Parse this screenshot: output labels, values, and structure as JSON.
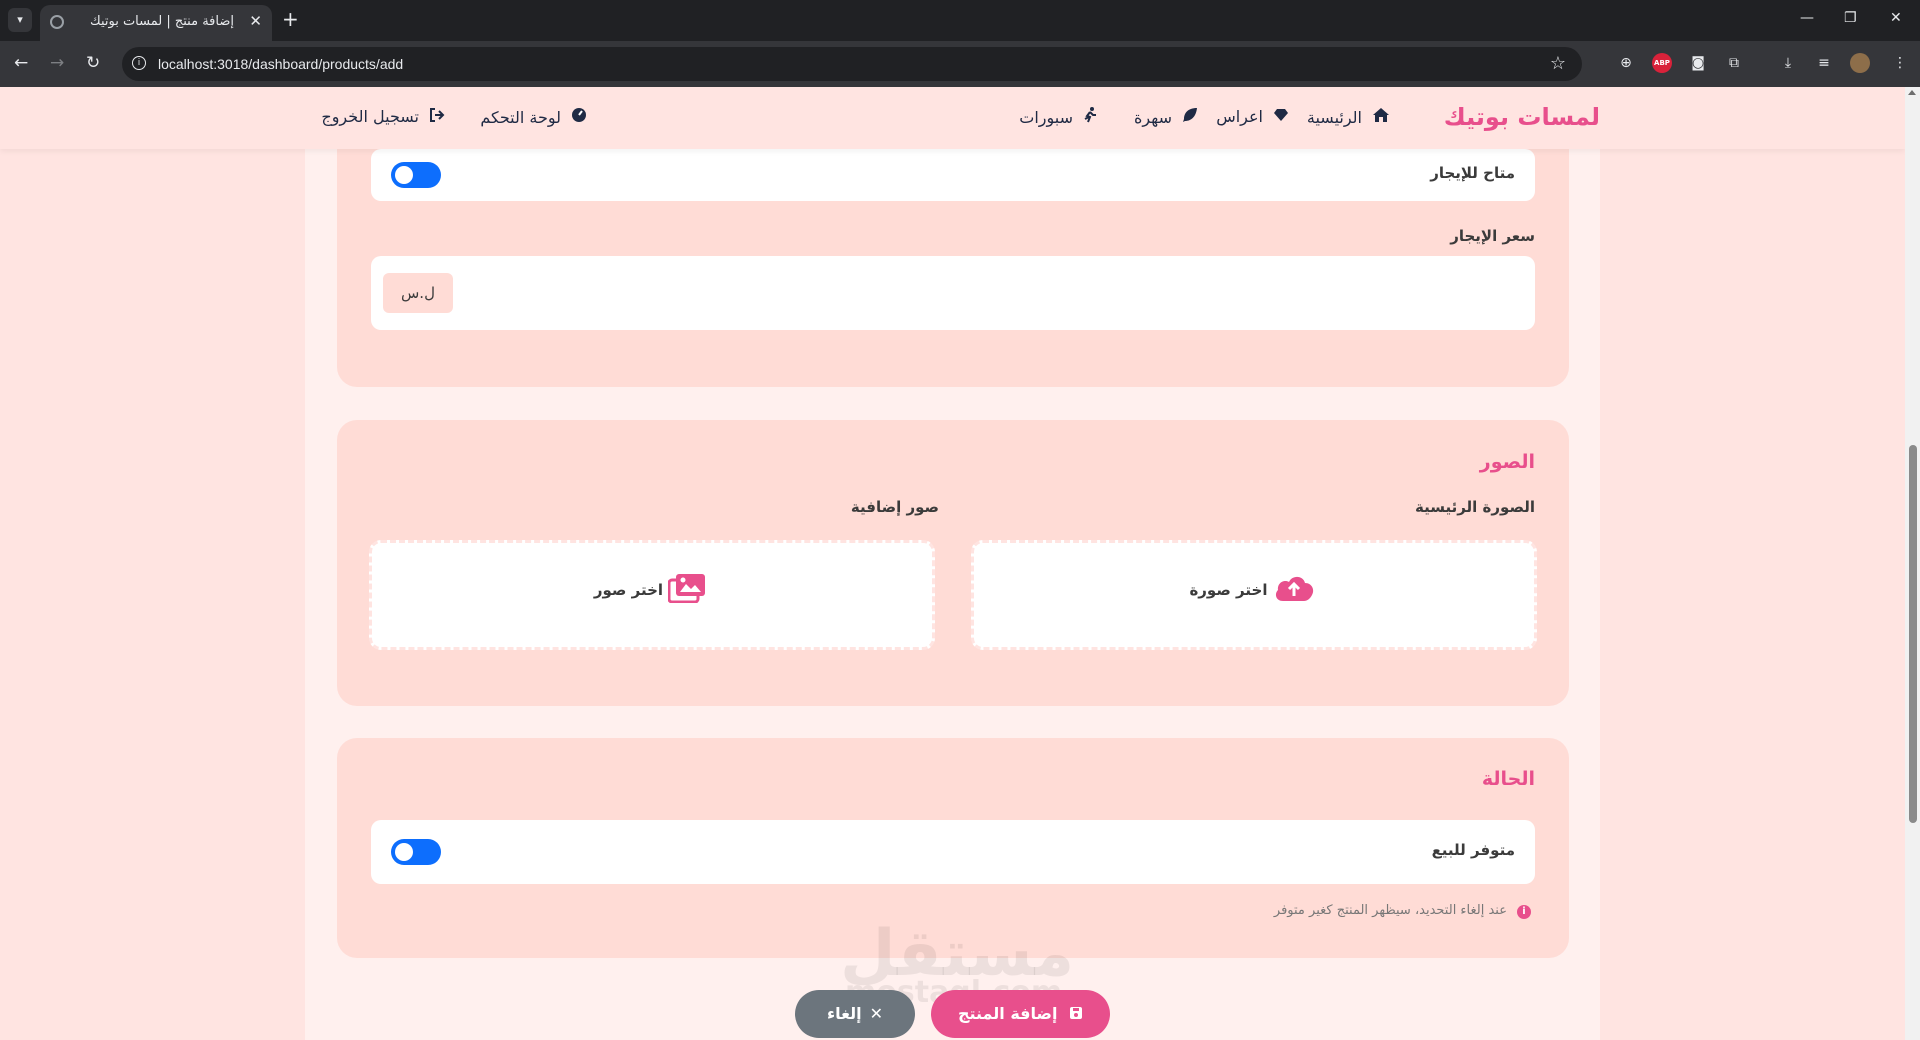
{
  "browser": {
    "tab_title": "إضافة منتج | لمسات بوتيك",
    "url": "localhost:3018/dashboard/products/add",
    "extensions": [
      "globe-icon",
      "adblock-icon",
      "camera-icon",
      "puzzle-icon"
    ],
    "abp_label": "ABP"
  },
  "navbar": {
    "brand": "لمسات بوتيك",
    "items": [
      {
        "label": "الرئيسية",
        "icon": "home-icon"
      },
      {
        "label": "اعراس",
        "icon": "gem-icon"
      },
      {
        "label": "سهرة",
        "icon": "leaf-icon"
      },
      {
        "label": "سبورات",
        "icon": "running-icon"
      }
    ],
    "dashboard": {
      "label": "لوحة التحكم",
      "icon": "gauge-icon"
    },
    "logout": {
      "label": "تسجيل الخروج",
      "icon": "sign-out-icon"
    }
  },
  "rental": {
    "available_label": "متاح للإيجار",
    "available_on": true,
    "price_label": "سعر الإيجار",
    "price_value": "",
    "currency": "ل.س"
  },
  "images": {
    "title": "الصور",
    "main_label": "الصورة الرئيسية",
    "main_button": "اختر صورة",
    "extra_label": "صور إضافية",
    "extra_button": "اختر صور"
  },
  "status": {
    "title": "الحالة",
    "for_sale_label": "متوفر للبيع",
    "for_sale_on": true,
    "hint": "عند إلغاء التحديد، سيظهر المنتج كغير متوفر"
  },
  "actions": {
    "submit": "إضافة المنتج",
    "cancel": "إلغاء"
  },
  "watermark": {
    "text": "مستقل",
    "sub": "mostaql.com"
  },
  "colors": {
    "accent": "#e84f8c",
    "toggle": "#0d6efd",
    "page_bg": "#ffe4e1",
    "card_bg": "#ffdcd6"
  }
}
